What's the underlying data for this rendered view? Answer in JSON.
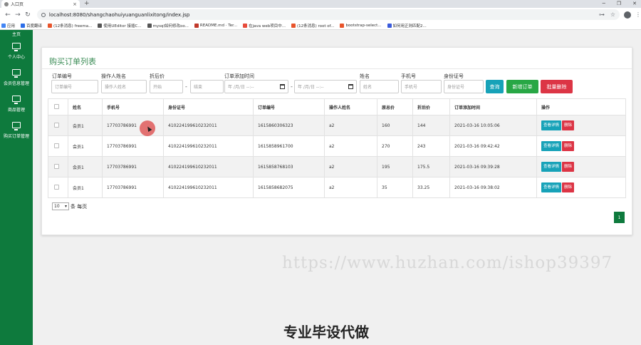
{
  "browser": {
    "tab_title": "入口页",
    "tab_close": "×",
    "new_tab": "+",
    "window_controls": [
      "─",
      "❐",
      "✕"
    ],
    "url": "localhost:8080/shangchaohuiyuanguanlixitong/index.jsp",
    "nav": {
      "back": "←",
      "forward": "→",
      "reload": "↻"
    },
    "omni_icons": [
      "⊶",
      "☆"
    ],
    "menu": "⋮",
    "bookmarks": [
      {
        "label": "应用",
        "color": "#4285f4"
      },
      {
        "label": "百度翻译",
        "color": "#2b6de8"
      },
      {
        "label": "(12条消息) freema...",
        "color": "#e8542b"
      },
      {
        "label": "使用UEditor 接插C...",
        "color": "#555555"
      },
      {
        "label": "mysql如何修改oo...",
        "color": "#555555"
      },
      {
        "label": "README.md · Ter...",
        "color": "#c0392b"
      },
      {
        "label": "在java web项目中...",
        "color": "#e74c3c"
      },
      {
        "label": "(12条消息) root of...",
        "color": "#e8542b"
      },
      {
        "label": "bootstrap-select...",
        "color": "#e8542b"
      },
      {
        "label": "如何用正则匹配2...",
        "color": "#3b5bdb"
      }
    ]
  },
  "sidebar": {
    "top_label": "主页",
    "items": [
      {
        "label": "个人中心"
      },
      {
        "label": "会员信息管理"
      },
      {
        "label": "商品管理"
      },
      {
        "label": "购买订单管理"
      }
    ]
  },
  "page": {
    "title": "购买订单列表",
    "filters": {
      "order_no": {
        "label": "订单编号",
        "placeholder": "订单编号"
      },
      "operator": {
        "label": "操作人姓名",
        "placeholder": "操作人姓名"
      },
      "discount": {
        "label": "折后价",
        "start": "开始",
        "end": "结束"
      },
      "added_time": {
        "label": "订单添加时间",
        "placeholder": "年 /月/日 --:--"
      },
      "name": {
        "label": "姓名",
        "placeholder": "姓名"
      },
      "phone": {
        "label": "手机号",
        "placeholder": "手机号"
      },
      "idcard": {
        "label": "身份证号",
        "placeholder": "身份证号"
      }
    },
    "buttons": {
      "search": "查询",
      "add": "新增订单",
      "batch_delete": "批量删除"
    },
    "colors": {
      "primary_green": "#0e7a3d",
      "search_btn": "#17a2b8",
      "add_btn": "#28a745",
      "delete_btn": "#dc3545"
    },
    "table": {
      "columns": [
        "姓名",
        "手机号",
        "身份证号",
        "订单编号",
        "操作人姓名",
        "原总价",
        "折后价",
        "订单添加时间",
        "操作"
      ],
      "rows": [
        {
          "name": "会员1",
          "phone": "17703786991",
          "idcard": "410224199610232011",
          "order_no": "1615860306323",
          "operator": "a2",
          "original": "160",
          "discount": "144",
          "time": "2021-03-16 10:05:06"
        },
        {
          "name": "会员1",
          "phone": "17703786991",
          "idcard": "410224199610232011",
          "order_no": "1615858961700",
          "operator": "a2",
          "original": "270",
          "discount": "243",
          "time": "2021-03-16 09:42:42"
        },
        {
          "name": "会员1",
          "phone": "17703786991",
          "idcard": "410224199610232011",
          "order_no": "1615858768103",
          "operator": "a2",
          "original": "195",
          "discount": "175.5",
          "time": "2021-03-16 09:39:28"
        },
        {
          "name": "会员1",
          "phone": "17703786991",
          "idcard": "410224199610232011",
          "order_no": "1615858682075",
          "operator": "a2",
          "original": "35",
          "discount": "33.25",
          "time": "2021-03-16 09:38:02"
        }
      ],
      "row_actions": {
        "view": "查看详情",
        "delete": "删除"
      }
    },
    "pagination": {
      "page_size": "10",
      "page_size_arrow": "▾",
      "page_size_suffix": "条 每页",
      "current_page": "1"
    }
  },
  "overlay": {
    "watermark": "https://www.huzhan.com/ishop39397",
    "ad_text": "专业毕设代做"
  }
}
